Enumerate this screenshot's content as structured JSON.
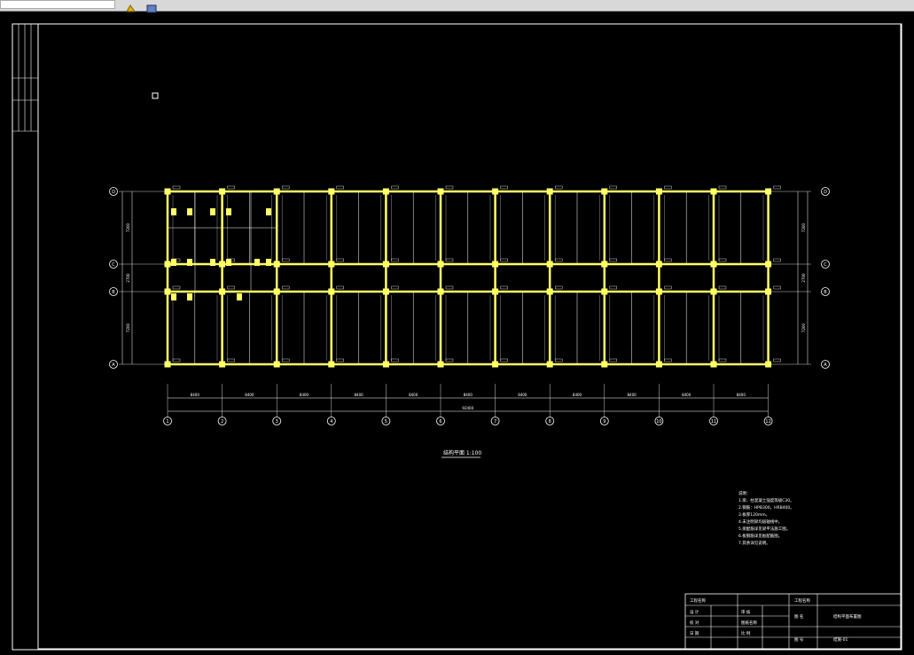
{
  "app": {
    "toolbar": {
      "layer_icon_a": "layer-properties-icon",
      "layer_icon_b": "layer-state-icon"
    }
  },
  "drawing": {
    "sheet_border_color": "#ffffff",
    "beam_color": "#ffff66",
    "grid_color": "#ffffff",
    "row_axes": [
      "D",
      "C",
      "B",
      "A"
    ],
    "col_axes": [
      "1",
      "2",
      "3",
      "4",
      "5",
      "6",
      "7",
      "8",
      "9",
      "10",
      "11",
      "12"
    ],
    "bay_dims": [
      "8400",
      "8400",
      "8400",
      "8400",
      "8400",
      "8400",
      "8400",
      "8400",
      "8400",
      "8400",
      "8400"
    ],
    "total_dim": "92400",
    "row_dims": [
      "7200",
      "2700",
      "7200"
    ],
    "plan_title": "结构平面 1:100",
    "notes": {
      "heading": "说明：",
      "lines": [
        "1.梁、柱混凝土强度等级C30。",
        "2.钢筋：HPB300，HRB400。",
        "3.板厚120mm。",
        "4.未注明梁均居轴线中。",
        "5.梁配筋详见梁平法施工图。",
        "6.板钢筋详见板配筋图。",
        "7.其余详见说明。"
      ]
    },
    "title_block": {
      "r1c1": "工程名称",
      "r1c3": "工程名称",
      "r2c1": "设 计",
      "r2c2": "审 核",
      "r3c1": "校 对",
      "r3c2": "图纸名称",
      "r4c1": "日 期",
      "r4c2": "比 例",
      "name_label": "图 名",
      "drawing_name": "结构平面布置图",
      "no_label": "图 号",
      "drawing_no": "结施-01"
    }
  }
}
